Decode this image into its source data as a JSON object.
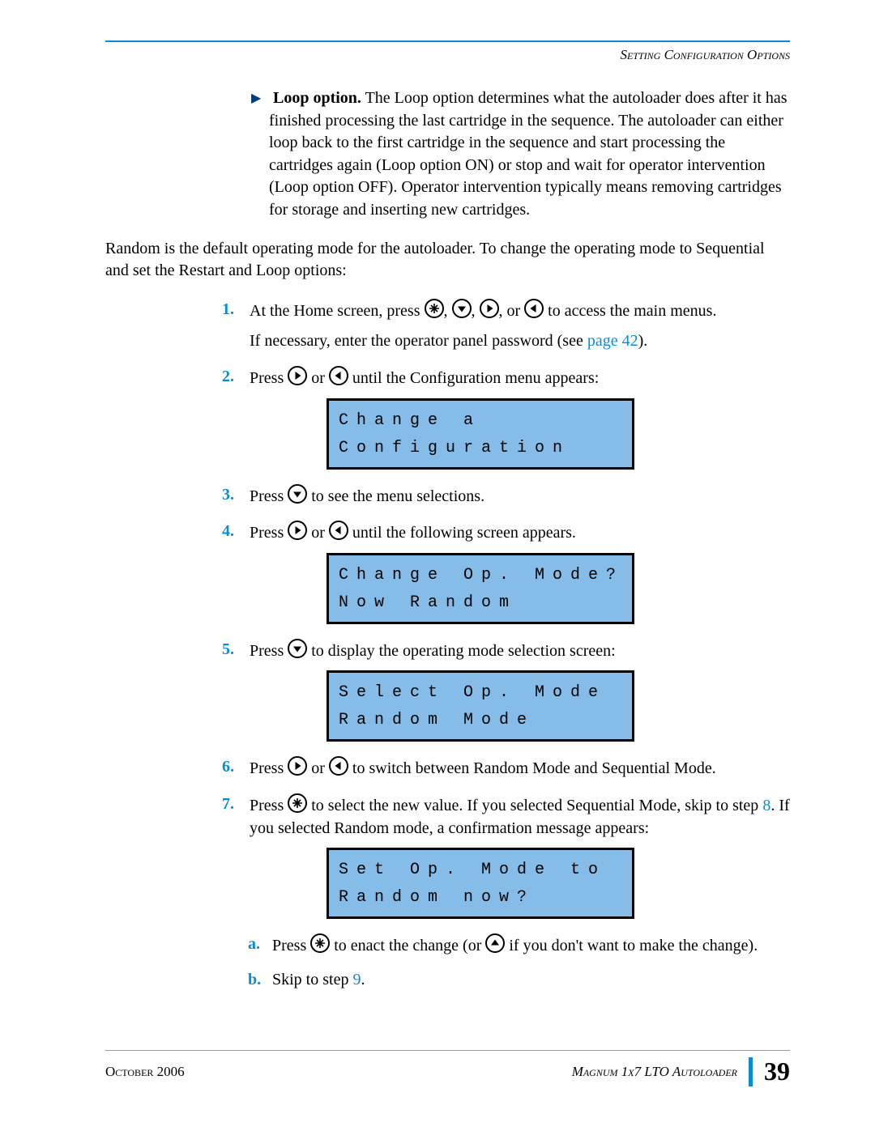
{
  "header": {
    "section_title": "Setting Configuration Options"
  },
  "loop_option": {
    "label": "Loop option.",
    "text": " The Loop option determines what the autoloader does after it has finished processing the last cartridge in the sequence. The autoloader can either loop back to the first cartridge in the sequence and start processing the cartridges again (Loop option ON) or stop and wait for operator intervention (Loop option OFF). Operator intervention typically means removing cartridges for storage and inserting new cartridges."
  },
  "random_intro": "Random is the default operating mode for the autoloader. To change the operating mode to Sequential and set the Restart and Loop options:",
  "steps": {
    "1": {
      "p1a": "At the Home screen, press ",
      "p1b": ", ",
      "p1c": ", ",
      "p1d": ", or ",
      "p1e": " to access the main menus.",
      "p2a": "If necessary, enter the operator panel password (see ",
      "p2link": "page 42",
      "p2b": ")."
    },
    "2": {
      "p1a": "Press ",
      "p1b": " or ",
      "p1c": " until the Configuration menu appears:",
      "lcd1": "Change a",
      "lcd2": "Configuration"
    },
    "3": {
      "p1a": "Press ",
      "p1b": " to see the menu selections."
    },
    "4": {
      "p1a": "Press ",
      "p1b": " or ",
      "p1c": " until the following screen appears.",
      "lcd1": "Change Op. Mode?",
      "lcd2": "Now Random"
    },
    "5": {
      "p1a": "Press ",
      "p1b": " to display the operating mode selection screen:",
      "lcd1": "Select Op. Mode",
      "lcd2": "Random Mode"
    },
    "6": {
      "p1a": "Press ",
      "p1b": " or ",
      "p1c": " to switch between Random Mode and Sequential Mode."
    },
    "7": {
      "p1a": "Press ",
      "p1b": " to select the new value. If you selected Sequential Mode, skip to step ",
      "p1link": "8",
      "p1c": ". If you selected Random mode, a confirmation message appears:",
      "lcd1": "Set Op. Mode to",
      "lcd2": "Random now?",
      "sub_a": {
        "p1a": "Press ",
        "p1b": " to enact the change (or ",
        "p1c": " if you don't want to make the change)."
      },
      "sub_b": {
        "p1a": "Skip to step ",
        "p1link": "9",
        "p1b": "."
      }
    }
  },
  "footer": {
    "date": "October 2006",
    "title": "Magnum 1x7 LTO Autoloader",
    "page": "39"
  }
}
